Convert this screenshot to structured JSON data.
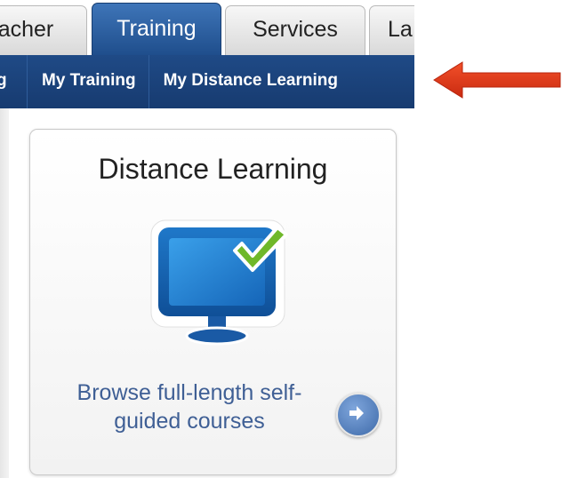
{
  "tabs": {
    "teacher_partial": "acher",
    "training": "Training",
    "services": "Services",
    "la_partial": "La"
  },
  "subnav": {
    "partial": "g",
    "my_training": "My Training",
    "my_distance_learning": "My Distance Learning"
  },
  "card": {
    "title": "Distance Learning",
    "link_line1": "Browse full-length self-",
    "link_line2": "guided courses"
  },
  "icons": {
    "monitor": "monitor-check-icon",
    "go": "arrow-right-circle-icon",
    "annotation": "red-arrow-left"
  },
  "colors": {
    "nav_blue": "#1f4a86",
    "link_blue": "#3f5f95",
    "annotation_red": "#e03a1a",
    "check_green": "#6fb82a"
  }
}
